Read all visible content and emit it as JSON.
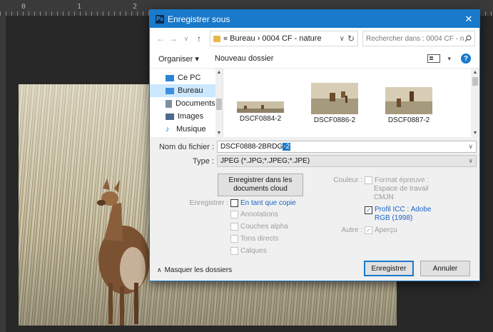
{
  "ruler": {
    "ticks": [
      "0",
      "1",
      "2"
    ]
  },
  "dialog": {
    "app_icon": "Ps",
    "title": "Enregistrer sous",
    "close_glyph": "✕",
    "nav": {
      "back": "←",
      "forward": "→",
      "recent": "∨",
      "up": "↑"
    },
    "address": {
      "crumbs": "« Bureau  ›  0004 CF - nature",
      "dropdown": "∨",
      "refresh": "↻"
    },
    "search": {
      "placeholder": "Rechercher dans : 0004 CF - na...",
      "icon": "search-icon"
    },
    "toolbar": {
      "organize": "Organiser ▾",
      "new_folder": "Nouveau dossier",
      "view": "▾",
      "help": "?"
    },
    "tree": [
      {
        "label": "Ce PC",
        "icon": "computer-icon",
        "color": "#2b84d6"
      },
      {
        "label": "Bureau",
        "icon": "desktop-icon",
        "color": "#3d8fe0",
        "selected": true
      },
      {
        "label": "Documents",
        "icon": "documents-icon",
        "color": "#7f8fa3"
      },
      {
        "label": "Images",
        "icon": "images-icon",
        "color": "#4a6b8a"
      },
      {
        "label": "Musique",
        "icon": "music-icon",
        "color": "#1e6fd0"
      }
    ],
    "thumbnails": [
      {
        "name": "DSCF0884-2"
      },
      {
        "name": "DSCF0886-2"
      },
      {
        "name": "DSCF0887-2"
      }
    ],
    "form": {
      "filename_label": "Nom du fichier :",
      "filename_value": "DSCF0888-2BRDG",
      "filename_selected": "-2",
      "type_label": "Type :",
      "type_value": "JPEG (*.JPG;*.JPEG;*.JPE)",
      "cloud_button": "Enregistrer dans les documents cloud",
      "save_label": "Enregistrer :",
      "as_copy": "En tant que copie",
      "annotations": "Annotations",
      "alpha": "Couches alpha",
      "spot": "Tons directs",
      "layers": "Calques",
      "color_label": "Couleur :",
      "proof_format": "Format épreuve :",
      "workspace": "Espace de travail",
      "cmjn": "CMJN",
      "icc_profile": "Profil ICC : Adobe RGB (1998)",
      "other_label": "Autre :",
      "preview": "Aperçu"
    },
    "footer": {
      "hide_folders": "Masquer les dossiers",
      "save": "Enregistrer",
      "cancel": "Annuler"
    }
  }
}
